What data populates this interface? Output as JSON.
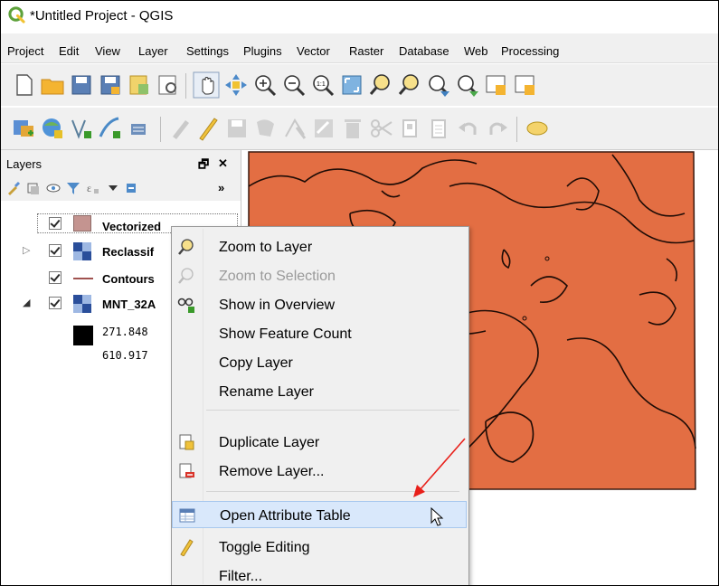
{
  "window": {
    "title": "*Untitled Project - QGIS"
  },
  "menubar": {
    "items": [
      {
        "label": "Project"
      },
      {
        "label": "Edit"
      },
      {
        "label": "View"
      },
      {
        "label": "Layer"
      },
      {
        "label": "Settings"
      },
      {
        "label": "Plugins"
      },
      {
        "label": "Vector"
      },
      {
        "label": "Raster"
      },
      {
        "label": "Database"
      },
      {
        "label": "Web"
      },
      {
        "label": "Processing"
      }
    ]
  },
  "toolbar1": {
    "icons": [
      "new-project-icon",
      "open-project-icon",
      "save-project-icon",
      "save-as-icon",
      "new-print-layout-icon",
      "layout-manager-icon",
      "pan-icon",
      "pan-to-selection-icon",
      "zoom-in-icon",
      "zoom-out-icon",
      "zoom-native-icon",
      "zoom-full-icon",
      "zoom-to-selection-icon",
      "zoom-to-layer-icon",
      "zoom-last-icon",
      "zoom-next-icon",
      "new-map-view-icon",
      "new-3d-view-icon"
    ]
  },
  "toolbar2": {
    "icons": [
      "data-source-manager-icon",
      "add-layer-icon",
      "digitize-icon",
      "add-line-icon",
      "add-point-icon",
      "current-edits-icon",
      "toggle-editing-icon",
      "save-edits-icon",
      "add-feature-icon",
      "vertex-tool-icon",
      "modify-attributes-icon",
      "delete-selected-icon",
      "cut-features-icon",
      "copy-features-icon",
      "paste-features-icon",
      "undo-icon",
      "redo-icon",
      "label-icon"
    ]
  },
  "layers_panel": {
    "title": "Layers",
    "float_glyph": "🗗",
    "close_glyph": "✕",
    "more_glyph": "»",
    "layers": [
      {
        "name": "Vectorized",
        "checked": true,
        "swatch": "#c49490"
      },
      {
        "name": "Reclassif",
        "checked": true,
        "swatch": "raster"
      },
      {
        "name": "Contours",
        "checked": true,
        "swatch": "line"
      },
      {
        "name": "MNT_32A",
        "checked": true,
        "swatch": "raster"
      }
    ],
    "legend": {
      "min": "271.848",
      "max": "610.917"
    }
  },
  "map": {
    "fill_color": "#e36e43"
  },
  "context_menu": {
    "items": [
      {
        "label": "Zoom to Layer",
        "icon": "zoom-to-layer-icon",
        "enabled": true
      },
      {
        "label": "Zoom to Selection",
        "icon": "zoom-to-selection-icon",
        "enabled": false
      },
      {
        "label": "Show in Overview",
        "icon": "overview-icon",
        "enabled": true
      },
      {
        "label": "Show Feature Count",
        "icon": "",
        "enabled": true
      },
      {
        "label": "Copy Layer",
        "icon": "",
        "enabled": true
      },
      {
        "label": "Rename Layer",
        "icon": "",
        "enabled": true
      },
      {
        "label": "Duplicate Layer",
        "icon": "duplicate-layer-icon",
        "enabled": true
      },
      {
        "label": "Remove Layer...",
        "icon": "remove-layer-icon",
        "enabled": true
      },
      {
        "label": "Open Attribute Table",
        "icon": "attribute-table-icon",
        "enabled": true,
        "highlighted": true
      },
      {
        "label": "Toggle Editing",
        "icon": "pencil-icon",
        "enabled": true
      },
      {
        "label": "Filter...",
        "icon": "",
        "enabled": true
      }
    ]
  },
  "annotation": {
    "arrow_color": "#e8201a"
  }
}
